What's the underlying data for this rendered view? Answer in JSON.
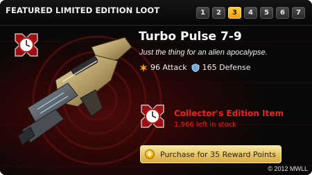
{
  "header": {
    "title": "FEATURED LIMITED EDITION LOOT",
    "pages": [
      "1",
      "2",
      "3",
      "4",
      "5",
      "6",
      "7"
    ],
    "active_page": "3"
  },
  "item": {
    "name": "Turbo Pulse 7-9",
    "tagline": "Just the thing for an alien apocalypse.",
    "attack_text": "96 Attack",
    "defense_text": "165 Defense",
    "collector_title": "Collector's Edition Item",
    "stock_text": "1,966 left in stock"
  },
  "purchase": {
    "label": "Purchase for 35 Reward Points"
  },
  "footer": {
    "copyright": "© 2012 MWLL"
  },
  "colors": {
    "accent_gold": "#f0b020",
    "collector_red": "#e8221e"
  },
  "icons": {
    "attack": "burst-icon",
    "defense": "shield-icon",
    "limited": "clock-medal-icon",
    "currency": "coin-icon"
  }
}
